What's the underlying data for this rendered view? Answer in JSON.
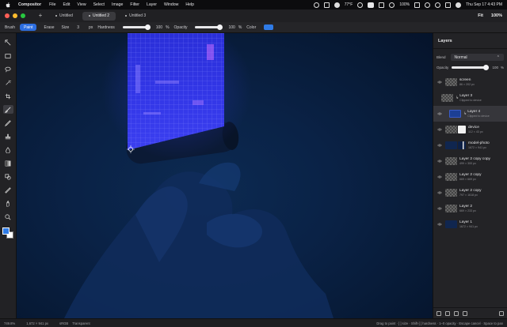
{
  "menubar": {
    "app_name": "Compositor",
    "menus": [
      "File",
      "Edit",
      "View",
      "Select",
      "Image",
      "Filter",
      "Layer",
      "Window",
      "Help"
    ],
    "weather": "77°F",
    "battery": "100%",
    "clock": "Thu Sep 17  4:43 PM"
  },
  "tabs": [
    {
      "label": "Untitled"
    },
    {
      "label": "Untitled 2"
    },
    {
      "label": "Untitled 3"
    }
  ],
  "titlebar": {
    "fit_label": "Fit",
    "zoom": "100%"
  },
  "options": {
    "tool_label": "Brush",
    "mode_paint": "Paint",
    "mode_erase": "Erase",
    "size_label": "Size",
    "size_value": "3",
    "size_unit": "px",
    "hardness_label": "Hardness",
    "hardness_value": "100",
    "hardness_pct": "%",
    "opacity_label": "Opacity",
    "opacity_value": "100",
    "opacity_pct": "%",
    "color_label": "Color",
    "color_hex": "#2f7be6"
  },
  "tools": [
    "move-icon",
    "marquee-icon",
    "lasso-icon",
    "magic-wand-icon",
    "crop-icon",
    "brush-icon",
    "pencil-icon",
    "stamp-icon",
    "fill-icon",
    "gradient-icon",
    "shape-icon",
    "eyedropper-icon",
    "hand-icon",
    "zoom-icon"
  ],
  "layers_panel": {
    "title": "Layers",
    "blend_label": "Blend",
    "blend_value": "Normal",
    "opacity_label": "Opacity",
    "opacity_value": "100",
    "opacity_pct": "%",
    "opacity_fraction": 1.0,
    "layers": [
      {
        "name": "screen",
        "sub": "86 × 202 px",
        "thumb": "checker",
        "clip": false
      },
      {
        "name": "Layer 3",
        "sub": "Clipped to device",
        "thumb": "checker",
        "clip": true
      },
      {
        "name": "Layer 4",
        "sub": "Clipped to device",
        "thumb": "blue",
        "clip": true,
        "selected": true
      },
      {
        "name": "device",
        "sub": "112 × 43 px",
        "thumb": "white",
        "clip": false
      },
      {
        "name": "model-photo",
        "sub": "1672 × 941 px",
        "thumb": "photo",
        "clip": false
      },
      {
        "name": "Layer 2 copy copy",
        "sub": "499 × 300 px",
        "thumb": "checker",
        "clip": false
      },
      {
        "name": "Layer 2 copy",
        "sub": "669 × 669 px",
        "thumb": "checker",
        "clip": false
      },
      {
        "name": "Layer 2 copy",
        "sub": "797 × 1618 px",
        "thumb": "checker",
        "clip": false
      },
      {
        "name": "Layer 2",
        "sub": "669 × 233 px",
        "thumb": "checker",
        "clip": false
      },
      {
        "name": "Layer 1",
        "sub": "1672 × 941 px",
        "thumb": "dark",
        "clip": false
      }
    ]
  },
  "status": {
    "zoom": "749.8%",
    "dimensions": "1,672 × 941 px",
    "color_mode": "sRGB",
    "background": "Transparent",
    "hint": "Drag to paint · [ ] size · Shift-[ ] hardness · 1–0 opacity · Escape cancel · Space to pan"
  }
}
